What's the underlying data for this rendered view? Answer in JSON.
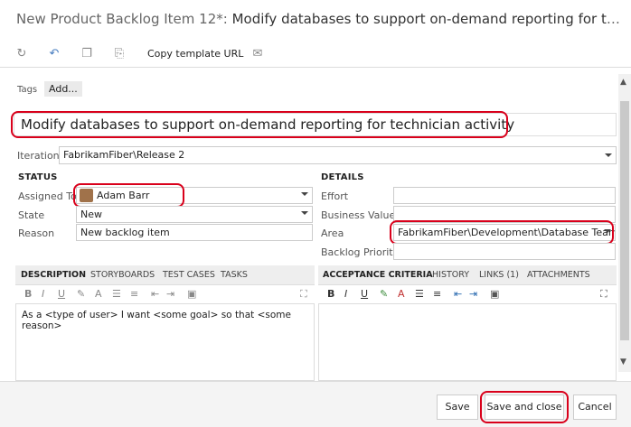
{
  "window": {
    "title_prefix": "New Product Backlog Item 12*: ",
    "title_main": "Modify databases to support on-demand reporting for technicia..."
  },
  "toolbar": {
    "icons": [
      "refresh-icon",
      "undo-icon",
      "template-icon",
      "copy-icon",
      "email-icon"
    ],
    "copy_template_url": "Copy template URL"
  },
  "tags": {
    "label": "Tags",
    "add_label": "Add..."
  },
  "work_item": {
    "title": "Modify databases to support on-demand reporting for technician activity",
    "iteration_label": "Iteration",
    "iteration_value": "FabrikamFiber\\Release 2"
  },
  "status": {
    "header": "STATUS",
    "assigned_to_label": "Assigned To",
    "assigned_to_value": "Adam Barr",
    "state_label": "State",
    "state_value": "New",
    "reason_label": "Reason",
    "reason_value": "New backlog item"
  },
  "details": {
    "header": "DETAILS",
    "effort_label": "Effort",
    "effort_value": "",
    "business_value_label": "Business Value",
    "business_value_value": "",
    "area_label": "Area",
    "area_value": "FabrikamFiber\\Development\\Database Team",
    "backlog_priority_label": "Backlog Priority",
    "backlog_priority_value": ""
  },
  "left_tabs": [
    "DESCRIPTION",
    "STORYBOARDS",
    "TEST CASES",
    "TASKS"
  ],
  "right_tabs": [
    "ACCEPTANCE CRITERIA",
    "HISTORY",
    "LINKS (1)",
    "ATTACHMENTS"
  ],
  "description_text": "As a <type of user> I want <some goal> so that <some reason>",
  "footer": {
    "save": "Save",
    "save_and_close": "Save and close",
    "cancel": "Cancel"
  },
  "colors": {
    "highlight": "#d9001b"
  }
}
